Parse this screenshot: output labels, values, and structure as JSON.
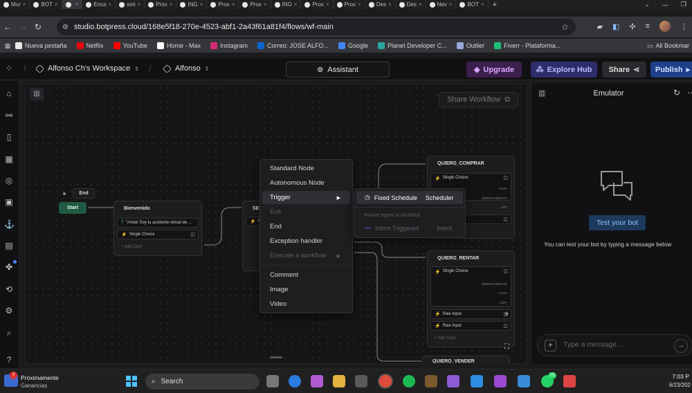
{
  "browser": {
    "tabs": [
      "Mur",
      "BOT",
      "",
      "Enca",
      "smi",
      "Prox",
      "ING",
      "Prox",
      "Prox",
      "ING",
      "Prox",
      "Prox",
      "Des",
      "Des",
      "Nev",
      "BOT"
    ],
    "url": "studio.botpress.cloud/168e5f18-270e-4523-abf1-2a43f61a81f4/flows/wf-main",
    "bookmarks": [
      "Nueva pestaña",
      "Netflix",
      "YouTube",
      "Home - Max",
      "Instagram",
      "Correo: JOSE ALFO...",
      "Google",
      "Planet Developer C...",
      "Outlier",
      "Fiverr - Plataforma..."
    ],
    "all_bookmarks": "All Bookmar"
  },
  "header": {
    "workspace": "Alfonso Ch's Workspace",
    "bot": "Alfonso",
    "assistant": "Assistant",
    "upgrade": "Upgrade",
    "explore_hub": "Explore Hub",
    "share": "Share",
    "publish": "Publish"
  },
  "canvas": {
    "share_workflow": "Share Workflow",
    "start": "Start",
    "end": "End",
    "bienvenida": {
      "title": "Bienvenido",
      "card1": "\"¡Hola! Soy tu asistente virtual de ...",
      "card2": "Single Choice",
      "add_card": "Add Card"
    },
    "mid_node_title": "SE",
    "mid_node_card": "N",
    "quiero_comprar": {
      "title": "QUIERO_COMPRAR",
      "card": "Single Choice",
      "choices": [
        "CASA",
        "DEPARTAMENTO",
        "LOT"
      ]
    },
    "quiero_rentar": {
      "title": "QUIERO_RENTAR",
      "card": "Single Choice",
      "choices": [
        "DEPARTAMENTO",
        "CASA",
        "LOFT"
      ],
      "raw1": "Raw Input",
      "raw2": "Raw Input",
      "add_card": "Add Card"
    },
    "quiero_vender": {
      "title": "QUIERO_VENDER"
    }
  },
  "context_menu": {
    "items": [
      "Standard Node",
      "Autonomous Node",
      "Trigger",
      "Exit",
      "End",
      "Exception handler",
      "Execute a workflow",
      "Comment",
      "Image",
      "Video"
    ],
    "submenu": {
      "fixed_schedule": "Fixed Schedule",
      "scheduler": "Scheduler",
      "router_disabled": "Router agent is disabled",
      "intent_triggered": "Intent Triggered",
      "intent": "Intent"
    }
  },
  "emulator": {
    "title": "Emulator",
    "test_bot": "Test your bot",
    "hint": "You can test your bot by typing a message below",
    "placeholder": "Type a message..."
  },
  "taskbar": {
    "weather_title": "Próximamente",
    "weather_sub": "Ganancias",
    "search": "Search",
    "time": "7:03 P",
    "date": "6/23/202",
    "notification_count": "7",
    "whatsapp_count": "15"
  }
}
